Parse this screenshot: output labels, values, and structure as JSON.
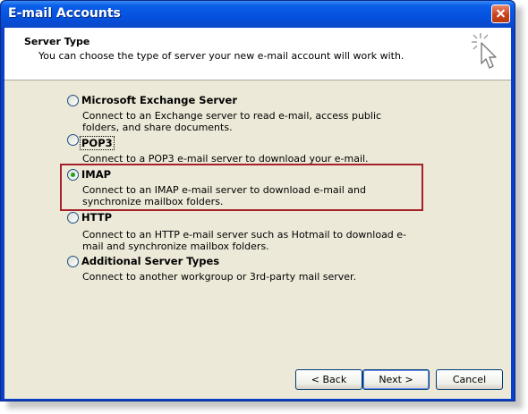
{
  "window": {
    "title": "E-mail Accounts"
  },
  "header": {
    "title": "Server Type",
    "subtitle": "You can choose the type of server your new e-mail account will work with."
  },
  "options": [
    {
      "label": "Microsoft Exchange Server",
      "mnemonic": "M",
      "selected": false,
      "description": "Connect to an Exchange server to read e-mail, access public folders, and share documents."
    },
    {
      "label": "POP3",
      "mnemonic": "P",
      "selected": false,
      "description": "Connect to a POP3 e-mail server to download your e-mail."
    },
    {
      "label": "IMAP",
      "mnemonic": "I",
      "selected": true,
      "description": "Connect to an IMAP e-mail server to download e-mail and synchronize mailbox folders."
    },
    {
      "label": "HTTP",
      "mnemonic": "H",
      "selected": false,
      "description": "Connect to an HTTP e-mail server such as Hotmail to download e-mail and synchronize mailbox folders."
    },
    {
      "label": "Additional Server Types",
      "mnemonic": "A",
      "selected": false,
      "description": "Connect to another workgroup or 3rd-party mail server."
    }
  ],
  "buttons": {
    "back": "< Back",
    "next": "Next >",
    "cancel": "Cancel"
  },
  "colors": {
    "titlebar": "#0651df",
    "dialog": "#ece9d8",
    "highlight_box": "#a6202a",
    "radio_dot": "#21a121"
  }
}
